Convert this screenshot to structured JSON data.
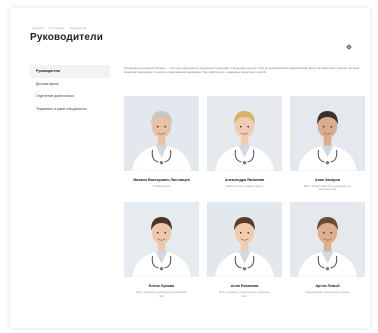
{
  "breadcrumb": [
    "Главная",
    "Об клинике",
    "Руководство"
  ],
  "page_title": "Руководители",
  "sidebar": {
    "items": [
      {
        "label": "Руководители",
        "active": true
      },
      {
        "label": "Детские врачи",
        "active": false
      },
      {
        "label": "Отделение диагностики",
        "active": false
      },
      {
        "label": "Терапевты и узкие специалисты",
        "active": false
      }
    ]
  },
  "intro": "Руководители нашей клиники — это опытные врачи с научными степенями и большим опытом. Под их руководством медицинский центр на заботится о ваших частной практики продолжает в центре современной медицины. Где заботиться о здоровье взрослых и детей.",
  "doctors": [
    {
      "name": "Михаил Викторович Листовцев",
      "role": "Главный врач",
      "coat": "#ffffff",
      "hair": "#c9c6c0",
      "skin": "#e8c2a4",
      "bg": "#e3e8ee"
    },
    {
      "name": "Александра Яковлева",
      "role": "Заместитель главного врача",
      "coat": "#ffffff",
      "hair": "#d8b169",
      "skin": "#f0cdb2",
      "bg": "#e6eaef"
    },
    {
      "name": "Алан Захаров",
      "role": "Врач общей практики, руководитель филиала №1",
      "coat": "#ffffff",
      "hair": "#3a3029",
      "skin": "#d9ad8c",
      "bg": "#e4e9ee"
    },
    {
      "name": "Елена Орлова",
      "role": "Врач терапевт, руководитель филиала №2",
      "coat": "#ffffff",
      "hair": "#4a3226",
      "skin": "#eec7aa",
      "bg": "#e6ebef"
    },
    {
      "name": "Алла Романова",
      "role": "Врач терапевт, руководитель филиала №3",
      "coat": "#ffffff",
      "hair": "#5a3b29",
      "skin": "#efcbb0",
      "bg": "#e3e8ed"
    },
    {
      "name": "Артем Левый",
      "role": "Заведующий отделением терапии",
      "coat": "#ffffff",
      "hair": "#6b4a33",
      "skin": "#dcae8c",
      "bg": "#e5e9ee"
    }
  ]
}
